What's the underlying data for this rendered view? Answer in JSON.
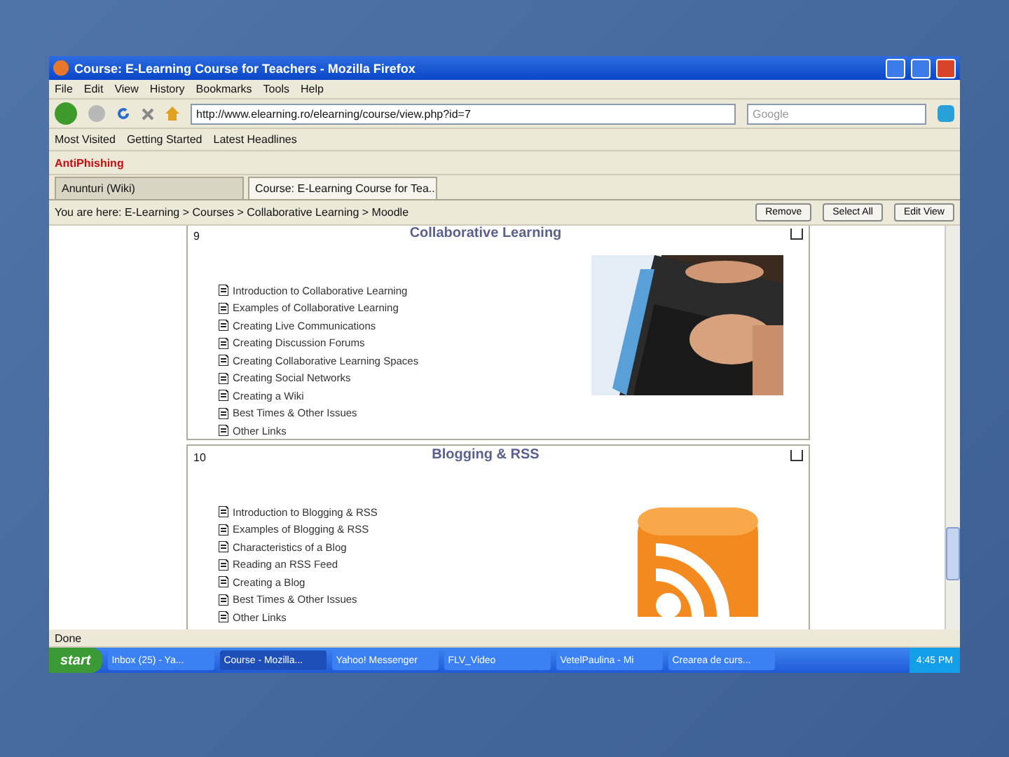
{
  "window": {
    "title": "Course: E-Learning Course for Teachers - Mozilla Firefox"
  },
  "menu": [
    "File",
    "Edit",
    "View",
    "History",
    "Bookmarks",
    "Tools",
    "Help"
  ],
  "address": {
    "value": "http://www.elearning.ro/elearning/course/view.php?id=7"
  },
  "search": {
    "placeholder": "Google"
  },
  "bookmarks": [
    "Most Visited",
    "Getting Started",
    "Latest Headlines"
  ],
  "addon": {
    "label": "AntiPhishing"
  },
  "tabs": [
    {
      "label": "Anunturi (Wiki)",
      "selected": false
    },
    {
      "label": "Course: E-Learning Course for Tea...",
      "selected": true
    }
  ],
  "find_bar": {
    "text": "You are here: E-Learning > Courses > Collaborative Learning > Moodle",
    "buttons": [
      "Remove",
      "Select All",
      "Edit View"
    ]
  },
  "sections": [
    {
      "number": "9",
      "title": "Collaborative Learning",
      "items": [
        "Introduction to Collaborative Learning",
        "Examples of Collaborative Learning",
        "Creating Live Communications",
        "Creating Discussion Forums",
        "Creating Collaborative Learning Spaces",
        "Creating Social Networks",
        "Creating a Wiki",
        "Best Times & Other Issues",
        "Other Links"
      ]
    },
    {
      "number": "10",
      "title": "Blogging & RSS",
      "kind": "rss",
      "items": [
        "Introduction to Blogging & RSS",
        "Examples of Blogging & RSS",
        "Characteristics of a Blog",
        "Reading an RSS Feed",
        "Creating a Blog",
        "Best Times & Other Issues",
        "Other Links"
      ]
    }
  ],
  "status_bar": "Done",
  "taskbar": {
    "start": "start",
    "tasks": [
      {
        "label": "Inbox (25) - Ya...",
        "selected": false
      },
      {
        "label": "Course - Mozilla...",
        "selected": true
      },
      {
        "label": "Yahoo! Messenger",
        "selected": false
      },
      {
        "label": "FLV_Video",
        "selected": false
      },
      {
        "label": "VetelPaulina - Mi",
        "selected": false
      },
      {
        "label": "Crearea de curs...",
        "selected": false
      }
    ],
    "clock": "4:45 PM"
  }
}
